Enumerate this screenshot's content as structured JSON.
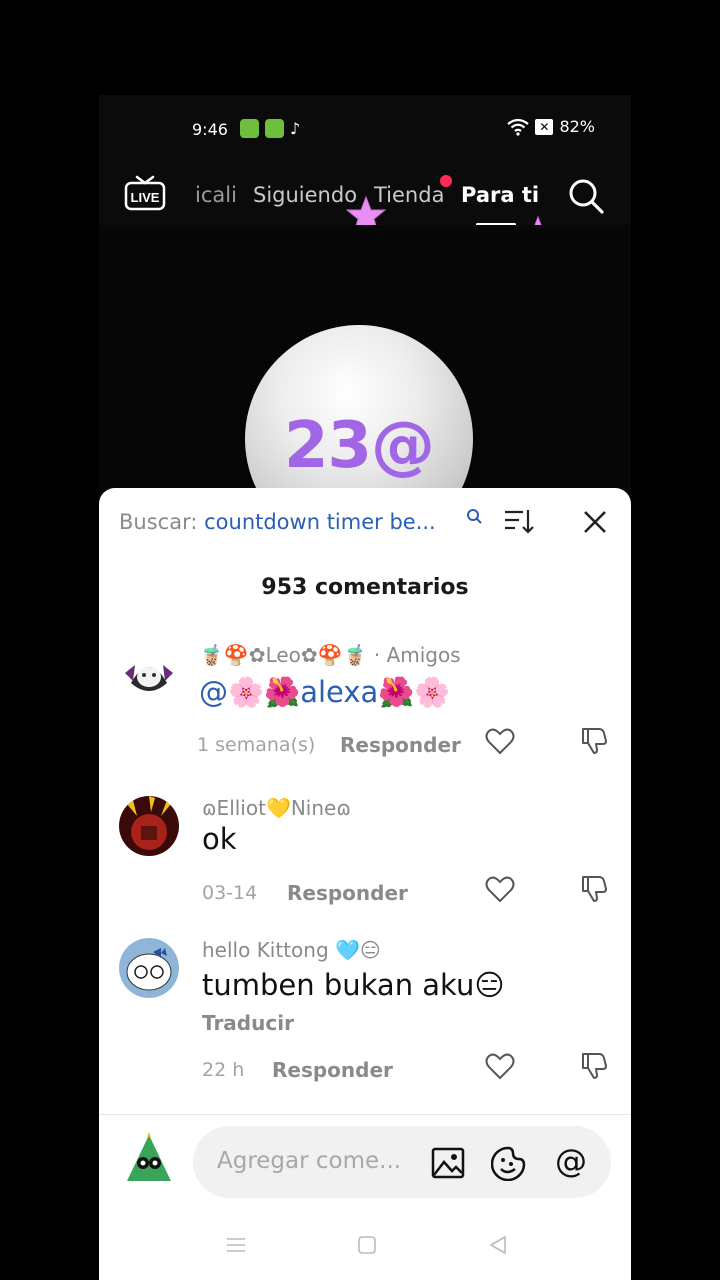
{
  "status_bar": {
    "time": "9:46",
    "battery": "82%"
  },
  "top_nav": {
    "tabs": [
      {
        "label": "icali"
      },
      {
        "label": "Siguiendo"
      },
      {
        "label": "Tienda"
      },
      {
        "label": "Para ti"
      }
    ],
    "active_tab": "Para ti"
  },
  "video": {
    "overlay_text": "23@"
  },
  "comments_sheet": {
    "search_label": "Buscar:",
    "search_term": "countdown timer be...",
    "count_label": "953 comentarios",
    "comments": [
      {
        "username": "🧋🍄✿Leo✿🍄🧋 · Amigos",
        "text": "@🌸🌺alexa🌺🌸",
        "time": "1 semana(s)",
        "reply_label": "Responder"
      },
      {
        "username": "ɷElliot💛Nineɷ",
        "text": "ok",
        "time": "03-14",
        "reply_label": "Responder"
      },
      {
        "username": "hello Kittong 🩵😑",
        "text": "tumben bukan aku😑",
        "translate_label": "Traducir",
        "time": "22 h",
        "reply_label": "Responder"
      }
    ]
  },
  "comment_input": {
    "placeholder": "Agregar come..."
  },
  "colors": {
    "accent_link": "#2b5fb4",
    "notification_dot": "#ff2b55",
    "ball_text": "#a066e6"
  }
}
